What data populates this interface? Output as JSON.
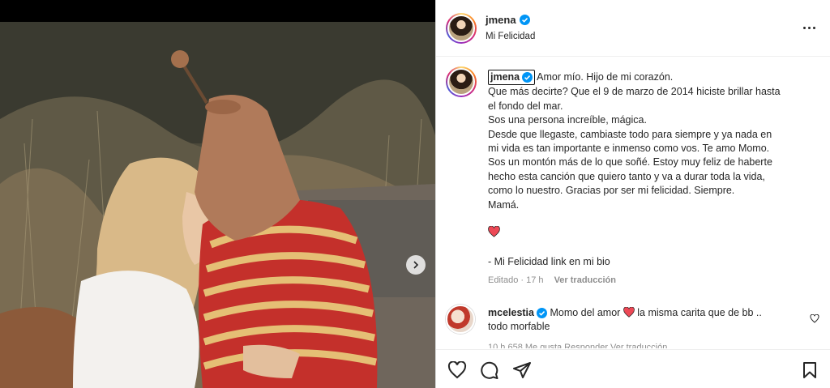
{
  "header": {
    "username": "jmena",
    "subtitle": "Mi Felicidad",
    "more_icon": "more-horizontal-icon"
  },
  "caption": {
    "username": "jmena",
    "lines": [
      "Amor mío. Hijo de mi corazón.",
      "Que más decirte? Que el 9 de marzo de 2014 hiciste brillar hasta",
      "el fondo del mar.",
      "Sos una persona increíble, mágica.",
      "Desde que llegaste, cambiaste todo para siempre y ya nada en",
      "mi vida es tan importante e inmenso como vos. Te amo Momo.",
      "Sos un montón más de lo que soñé. Estoy muy feliz de haberte",
      "hecho esta canción que quiero tanto y va a durar toda la vida,",
      "como lo nuestro. Gracias por ser mi felicidad. Siempre.",
      "Mamá."
    ],
    "heart": "❤️",
    "link_line": "- Mi Felicidad link en mi bio",
    "edited": "Editado",
    "time": "17 h",
    "translate": "Ver traducción"
  },
  "comment": {
    "username": "mcelestia",
    "text_before": "Momo del amor",
    "text_after": "la misma carita que de bb ..",
    "line2": "todo morfable",
    "meta": "10 h   658 Me gusta   Responder   Ver traducción"
  },
  "colors": {
    "verified": "#0095f6",
    "heart": "#ed4956",
    "muted": "#8e8e8e"
  }
}
